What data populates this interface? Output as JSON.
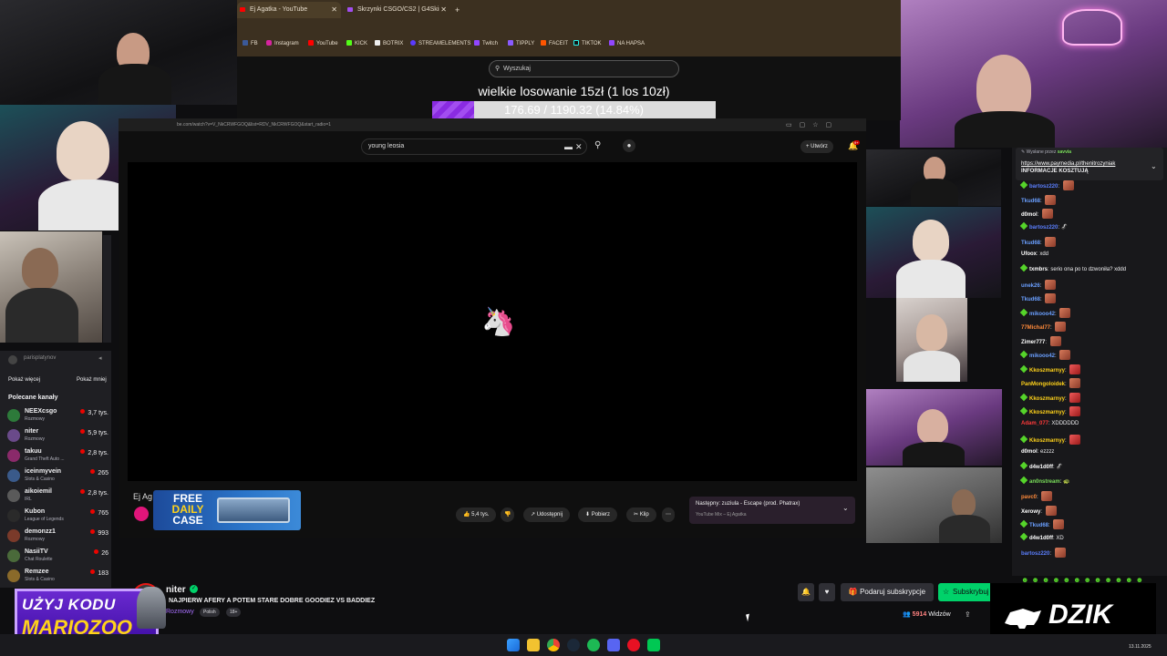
{
  "browser": {
    "tabs": [
      {
        "label": "Ej Agatka - YouTube",
        "active": true
      },
      {
        "label": "Skrzynki CSGO/CS2 | G4Skins",
        "active": false
      }
    ],
    "new_tab": "+",
    "bookmarks": [
      "FB",
      "Instagram",
      "YouTube",
      "KICK",
      "BOTRIX",
      "STREAMELEMENTS",
      "Twitch",
      "TIPPLY",
      "FACEIT",
      "TIKTOK",
      "NA HAPSA"
    ]
  },
  "overlay": {
    "search_placeholder": "Wyszukaj",
    "lottery_title": "wielkie losowanie 15zł (1 los 10zł)",
    "progress_text": "176.69 / 1190.32 (14.84%)",
    "progress_fraction": 0.1484
  },
  "youtube": {
    "url": "be.com/watch?v=V_NkCRWFGOQ&list=RDV_NkCRWFGOQ&start_radio=1",
    "search_value": "young leosia",
    "create_label": "Utwórz",
    "notif_count": "9+",
    "channel_short": "Ej Ag",
    "likes": "5,4 tys.",
    "share_label": "Udostępnij",
    "download_label": "Pobierz",
    "clip_label": "Klip",
    "next_title": "Następny: zuziula - Escape (prod. Phatrax)",
    "next_sub": "YouTube Mix – Ej Agatka"
  },
  "ad": {
    "line1": "FREE",
    "line2": "DAILY",
    "line3": "CASE"
  },
  "sidebar": {
    "top_user": "parisplatynov",
    "show_more": "Pokaż więcej",
    "show_less": "Pokaż mniej",
    "recommended_header": "Polecane kanały",
    "channels": [
      {
        "name": "NEEXcsgo",
        "category": "Rozmowy",
        "viewers": "3,7 tys.",
        "color": "#2d7a3a"
      },
      {
        "name": "niter",
        "category": "Rozmowy",
        "viewers": "5,9 tys.",
        "color": "#6a4a8a"
      },
      {
        "name": "takuu",
        "category": "Grand Theft Auto ...",
        "viewers": "2,8 tys.",
        "color": "#8a2a6a"
      },
      {
        "name": "iceinmyvein",
        "category": "Slots & Casino",
        "viewers": "265",
        "color": "#3a5a8a"
      },
      {
        "name": "aikoiemil",
        "category": "IRL",
        "viewers": "2,8 tys.",
        "color": "#5a5a5a"
      },
      {
        "name": "Kubon",
        "category": "League of Legends",
        "viewers": "765",
        "color": "#2a2a2a"
      },
      {
        "name": "demonzz1",
        "category": "Rozmowy",
        "viewers": "993",
        "color": "#7a3a2a"
      },
      {
        "name": "NasiiTV",
        "category": "Chat Roulette",
        "viewers": "26",
        "color": "#4a6a3a"
      },
      {
        "name": "Remzee",
        "category": "Slots & Casino",
        "viewers": "183",
        "color": "#8a6a2a"
      }
    ]
  },
  "stream": {
    "name": "niter",
    "title": "NAJPIERW AFERY A POTEM STARE DOBRE GOODIEZ VS BADDIEZ",
    "category": "Rozmowy",
    "tags": [
      "Polish",
      "18+"
    ],
    "gift_label": "Podaruj subskrypcje",
    "sub_label": "Subskrybuj",
    "viewers": "5914",
    "viewers_label": "Widzów"
  },
  "chat": {
    "pinned_by": "Wysłane przez",
    "pinned_user": "savvia",
    "pinned_link": "https://www.paymedia.pl/thenitrozyniak",
    "pinned_text": "INFORMACJE KOSZTUJĄ",
    "messages": [
      {
        "user": "bartosz220",
        "text": "",
        "color": "#5b7fff",
        "emote": true
      },
      {
        "user": "Tkud68",
        "text": "",
        "color": "#6a9fff",
        "emote": true
      },
      {
        "user": "d0mol",
        "text": "",
        "color": "#ffffff",
        "emote": true
      },
      {
        "user": "bartosz220",
        "text": "🦨",
        "color": "#5b7fff",
        "emote": false
      },
      {
        "user": "Tkud68",
        "text": "",
        "color": "#6a9fff",
        "emote": true
      },
      {
        "user": "Ufoox",
        "text": "xdd",
        "color": "#ffffff",
        "emote": false
      },
      {
        "user": "txmbrs",
        "text": "serio ona po to dzwoniła? xddd",
        "color": "#ffffff",
        "emote": false
      },
      {
        "user": "unek26",
        "text": "",
        "color": "#6a9fff",
        "emote": true
      },
      {
        "user": "Tkud68",
        "text": "",
        "color": "#6a9fff",
        "emote": true
      },
      {
        "user": "mikooo42",
        "text": "",
        "color": "#6a9fff",
        "emote": true
      },
      {
        "user": "77Michal77",
        "text": "",
        "color": "#ff8a3a",
        "emote": true
      },
      {
        "user": "Zimer777",
        "text": "",
        "color": "#ffffff",
        "emote": true
      },
      {
        "user": "mikooo42",
        "text": "",
        "color": "#6a9fff",
        "emote": true
      },
      {
        "user": "Kkoszmarnyy",
        "text": "",
        "color": "#ffd21a",
        "emote": true
      },
      {
        "user": "PanMongoloidek",
        "text": "",
        "color": "#ffd21a",
        "emote": true
      },
      {
        "user": "Kkoszmarnyy",
        "text": "",
        "color": "#ffd21a",
        "emote": true
      },
      {
        "user": "Kkoszmarnyy",
        "text": "",
        "color": "#ffd21a",
        "emote": true
      },
      {
        "user": "Adam_077",
        "text": "XDDDDDD",
        "color": "#ff3a3a",
        "emote": false
      },
      {
        "user": "Kkoszmarnyy",
        "text": "",
        "color": "#ffd21a",
        "emote": true
      },
      {
        "user": "d0mol",
        "text": "ezzzz",
        "color": "#ffffff",
        "emote": false
      },
      {
        "user": "d4w1d0ff",
        "text": "🦨",
        "color": "#ffffff",
        "emote": false
      },
      {
        "user": "an0nstream",
        "text": "🐢",
        "color": "#7adf5a",
        "emote": false
      },
      {
        "user": "pavc0",
        "text": "",
        "color": "#ff8a3a",
        "emote": true
      },
      {
        "user": "Xerowy",
        "text": "",
        "color": "#ffffff",
        "emote": true
      },
      {
        "user": "Tkud68",
        "text": "",
        "color": "#6a9fff",
        "emote": true
      },
      {
        "user": "d4w1d0ff",
        "text": "XD",
        "color": "#ffffff",
        "emote": false
      },
      {
        "user": "bartosz220",
        "text": "",
        "color": "#5b7fff",
        "emote": true
      }
    ]
  },
  "promo": {
    "line1": "UŻYJ KODU",
    "line2": "MARIOZOO"
  },
  "brand": {
    "dzik": "DZIK"
  },
  "taskbar": {
    "date": "13.11.2025"
  }
}
